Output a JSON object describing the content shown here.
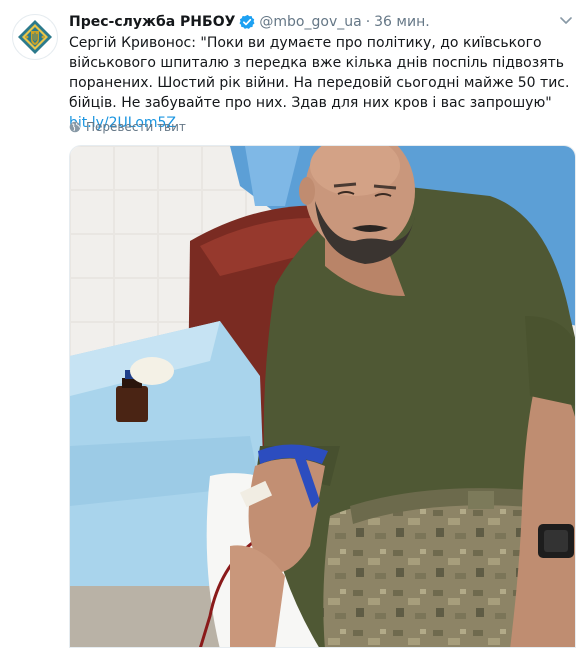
{
  "tweet": {
    "author_name": "Прес-служба РНБОУ",
    "handle": "@mbo_gov_ua",
    "separator": "·",
    "time": "36 мин.",
    "text_main": "Сергій Кривонос: \"Поки ви думаєте про політику, до київського військового шпиталю з передка вже кілька днів поспіль підвозять поранених. Шостий рік війни. На передовій сьогодні майже 50 тис. бійців. Не забувайте про них. Здав для них кров і вас запрошую\" ",
    "link_text": "bit.ly/2ULom5Z",
    "translate_label": "Перевести твит"
  },
  "colors": {
    "verified_blue": "#1da1f2",
    "link_blue": "#1b95e0",
    "muted_gray": "#657786",
    "emblem_gold": "#c9a227",
    "emblem_teal": "#2c7a8c"
  },
  "icons": {
    "verified": "verified-badge-icon",
    "caret": "chevron-down-icon",
    "translate": "globe-icon",
    "avatar": "rnbo-emblem-logo"
  }
}
